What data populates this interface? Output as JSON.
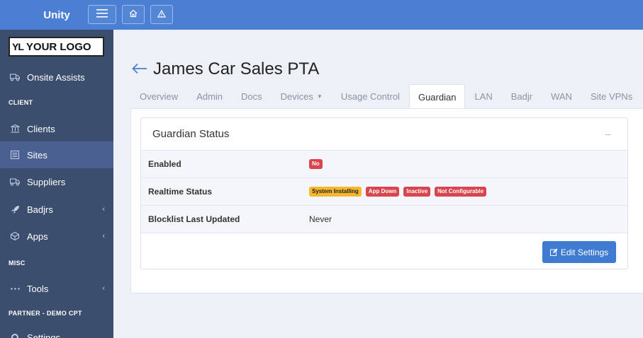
{
  "app": {
    "brand": "Unity"
  },
  "logo": {
    "mark": "YL",
    "text": "YOUR LOGO"
  },
  "sidebar": {
    "items": [
      {
        "label": "Onsite Assists",
        "icon": "truck-icon"
      },
      {
        "label": "Clients",
        "icon": "bank-icon"
      },
      {
        "label": "Sites",
        "icon": "list-icon",
        "active": true
      },
      {
        "label": "Suppliers",
        "icon": "truck-icon"
      },
      {
        "label": "Badjrs",
        "icon": "rocket-icon",
        "chevron": "‹"
      },
      {
        "label": "Apps",
        "icon": "cube-icon",
        "chevron": "‹"
      },
      {
        "label": "Tools",
        "icon": "dots-icon",
        "chevron": "‹"
      }
    ],
    "sections": [
      "CLIENT",
      "MISC",
      "PARTNER - DEMO CPT"
    ],
    "cut_item": "Settings"
  },
  "page": {
    "title": "James Car Sales PTA"
  },
  "tabs": [
    {
      "label": "Overview"
    },
    {
      "label": "Admin"
    },
    {
      "label": "Docs"
    },
    {
      "label": "Devices",
      "dropdown": true
    },
    {
      "label": "Usage Control"
    },
    {
      "label": "Guardian",
      "active": true
    },
    {
      "label": "LAN"
    },
    {
      "label": "Badjr"
    },
    {
      "label": "WAN"
    },
    {
      "label": "Site VPNs"
    }
  ],
  "card": {
    "title": "Guardian Status",
    "collapse": "–",
    "rows": [
      {
        "label": "Enabled",
        "badges": [
          {
            "text": "No",
            "color": "#d9454e"
          }
        ]
      },
      {
        "label": "Realtime Status",
        "badges": [
          {
            "text": "System Installing",
            "color": "#f5b82e"
          },
          {
            "text": "App Down",
            "color": "#d9454e"
          },
          {
            "text": "Inactive",
            "color": "#d9454e"
          },
          {
            "text": "Not Configurable",
            "color": "#d9454e"
          }
        ]
      },
      {
        "label": "Blocklist Last Updated",
        "value": "Never"
      }
    ],
    "edit_button": "Edit Settings"
  },
  "colors": {
    "topbar": "#4a7fd4",
    "sidebar": "#3c4e6e",
    "primary": "#3f7bd0",
    "danger": "#d9454e",
    "warning": "#f5b82e"
  }
}
